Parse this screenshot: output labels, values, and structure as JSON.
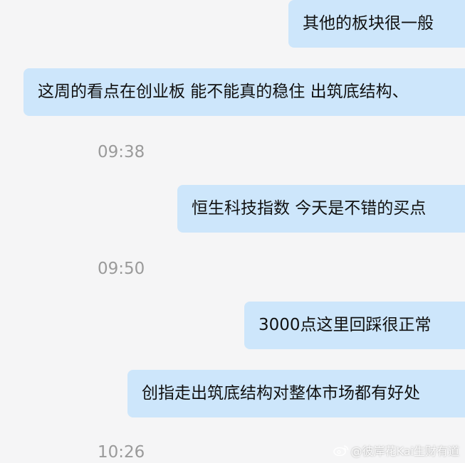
{
  "messages": [
    {
      "text": "其他的板块很一般"
    },
    {
      "text": "这周的看点在创业板 能不能真的稳住 出筑底结构、"
    },
    {
      "text": "恒生科技指数 今天是不错的买点"
    },
    {
      "text": "3000点这里回踩很正常"
    },
    {
      "text": "创指走出筑底结构对整体市场都有好处"
    }
  ],
  "timestamps": [
    "09:38",
    "09:50",
    "10:26"
  ],
  "watermark": {
    "icon": "weibo-icon",
    "text": "@彼岸花Kai生财有道"
  },
  "colors": {
    "background": "#f5f5f6",
    "bubble": "#cde6fb",
    "timestamp": "#9a9a9a"
  }
}
